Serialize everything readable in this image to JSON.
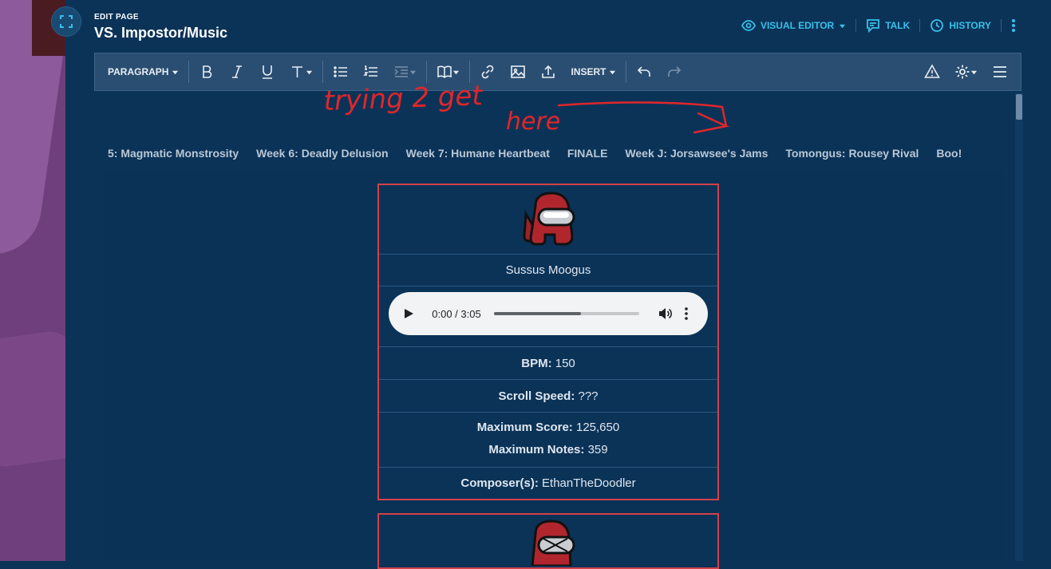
{
  "header": {
    "edit_label": "EDIT PAGE",
    "page_title": "VS. Impostor/Music",
    "actions": {
      "visual_editor": "VISUAL EDITOR",
      "talk": "TALK",
      "history": "HISTORY"
    }
  },
  "toolbar": {
    "paragraph": "PARAGRAPH",
    "insert": "INSERT",
    "icons": [
      "bold-icon",
      "italic-icon",
      "underline-icon",
      "text-style-icon",
      "bullet-list-icon",
      "numbered-list-icon",
      "indent-icon",
      "cite-icon",
      "link-icon",
      "image-icon",
      "upload-icon",
      "undo-icon",
      "redo-icon",
      "warning-icon",
      "settings-icon",
      "menu-icon"
    ]
  },
  "tabs": [
    "5: Magmatic Monstrosity",
    "Week 6: Deadly Delusion",
    "Week 7: Humane Heartbeat",
    "FINALE",
    "Week J: Jorsawsee's Jams",
    "Tomongus: Rousey Rival",
    "Boo!"
  ],
  "annotation": {
    "line1": "trying 2 get",
    "line2": "here"
  },
  "song": {
    "name": "Sussus Moogus",
    "audio_time": "0:00 / 3:05",
    "audio_progress": 0.6,
    "bpm_label": "BPM:",
    "bpm_value": "150",
    "speed_label": "Scroll Speed:",
    "speed_value": "???",
    "score_label": "Maximum Score:",
    "score_value": "125,650",
    "notes_label": "Maximum Notes:",
    "notes_value": "359",
    "composer_label": "Composer(s):",
    "composer_value": "EthanTheDoodler"
  },
  "colors": {
    "accent": "#39c0ea",
    "link": "#34b6e3",
    "card_border": "#d2414a",
    "annotation": "#e0262a",
    "background": "#0b3358"
  }
}
